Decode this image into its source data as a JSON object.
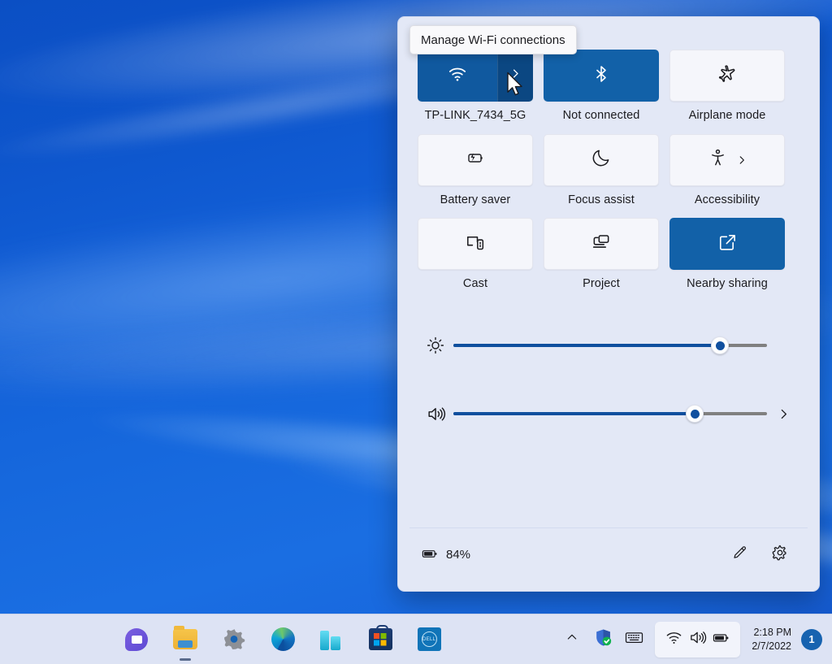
{
  "tooltip": {
    "text": "Manage Wi-Fi connections"
  },
  "quick_settings": {
    "tiles": [
      [
        {
          "label": "TP-LINK_7434_5G",
          "icon": "wifi-icon",
          "state": "active-split",
          "expand_icon": "chevron-right-icon"
        },
        {
          "label": "Not connected",
          "icon": "bluetooth-icon",
          "state": "active"
        },
        {
          "label": "Airplane mode",
          "icon": "airplane-icon",
          "state": "inactive"
        }
      ],
      [
        {
          "label": "Battery saver",
          "icon": "battery-saver-icon",
          "state": "inactive"
        },
        {
          "label": "Focus assist",
          "icon": "moon-icon",
          "state": "inactive"
        },
        {
          "label": "Accessibility",
          "icon": "accessibility-icon",
          "state": "inactive",
          "expand_icon": "chevron-right-icon"
        }
      ],
      [
        {
          "label": "Cast",
          "icon": "cast-icon",
          "state": "inactive"
        },
        {
          "label": "Project",
          "icon": "project-icon",
          "state": "inactive"
        },
        {
          "label": "Nearby sharing",
          "icon": "nearby-sharing-icon",
          "state": "active"
        }
      ]
    ],
    "sliders": [
      {
        "name": "brightness",
        "icon": "brightness-icon",
        "value": 85
      },
      {
        "name": "volume",
        "icon": "volume-icon",
        "value": 77,
        "end_icon": "chevron-right-icon"
      }
    ],
    "footer": {
      "battery_icon": "battery-icon",
      "battery_percent": "84%",
      "edit_icon": "pencil-icon",
      "settings_icon": "gear-icon"
    }
  },
  "taskbar": {
    "apps": [
      {
        "name": "chat-app",
        "icon": "chat-icon",
        "running": false
      },
      {
        "name": "file-explorer",
        "icon": "folder-icon",
        "running": true
      },
      {
        "name": "settings-app",
        "icon": "gear-icon",
        "running": false
      },
      {
        "name": "microsoft-edge",
        "icon": "edge-icon",
        "running": false
      },
      {
        "name": "server-manager",
        "icon": "server-icon",
        "running": false
      },
      {
        "name": "microsoft-store",
        "icon": "store-icon",
        "running": false
      },
      {
        "name": "dell-app",
        "icon": "dell-icon",
        "running": false
      }
    ],
    "tray": {
      "overflow_icon": "chevron-up-icon",
      "defender_icon": "shield-check-icon",
      "keyboard_icon": "keyboard-icon",
      "group": [
        "wifi-icon",
        "volume-icon",
        "battery-icon"
      ],
      "time": "2:18 PM",
      "date": "2/7/2022",
      "notification_count": "1"
    }
  },
  "colors": {
    "panel_bg": "#e3e8f6",
    "tile_inactive": "#f5f6fb",
    "tile_active": "#1261a8",
    "tile_wifi_main": "#10599f",
    "tile_wifi_expand": "#0b4782",
    "slider_fill": "#0f4f9e",
    "slider_track": "#808080",
    "taskbar_bg": "#dde3f4",
    "accent": "#1763b0"
  }
}
